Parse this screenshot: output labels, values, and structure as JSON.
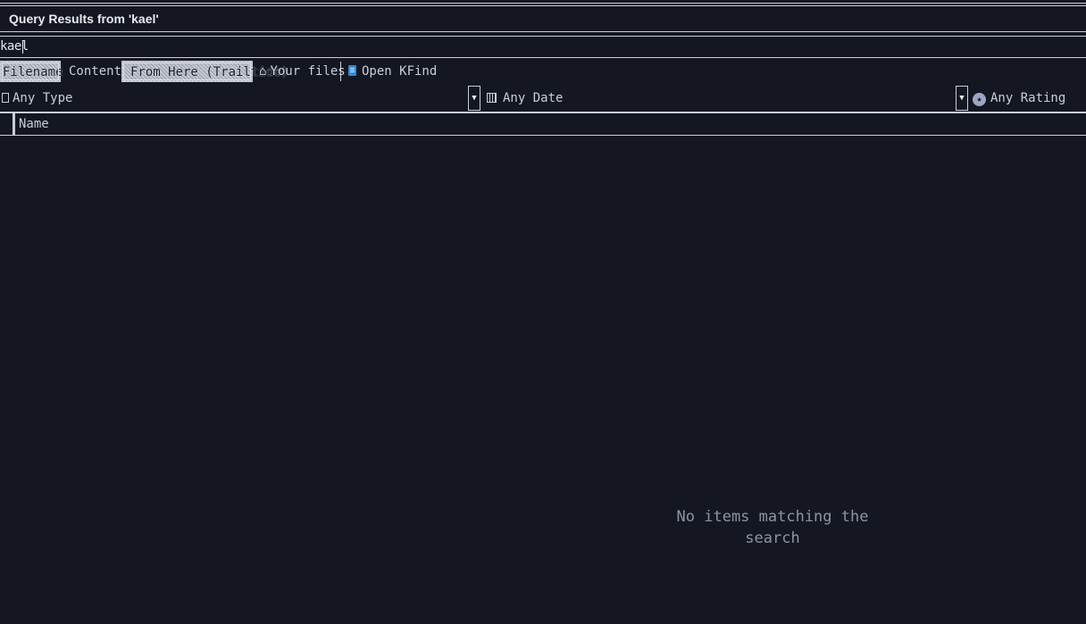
{
  "window": {
    "title": "Query Results from 'kael'"
  },
  "search": {
    "value": "kael"
  },
  "toolbar": {
    "filename": "Filename",
    "content": "Content",
    "from_here": "From Here (Trailtide)",
    "your_files": "Your files",
    "open_kfind": "Open KFind"
  },
  "filters": {
    "type": "Any Type",
    "date": "Any Date",
    "rating": "Any Rating"
  },
  "columns": {
    "name": "Name"
  },
  "results": {
    "empty_message": "No items matching the search"
  },
  "icons": {
    "home": "home-icon",
    "kfind": "kfind-icon",
    "file": "file-icon",
    "calendar": "calendar-icon",
    "star": "star-icon"
  },
  "colors": {
    "background": "#141722",
    "border": "#c9cdd6",
    "text": "#c9ced8",
    "accent": "#2f8bdc"
  }
}
